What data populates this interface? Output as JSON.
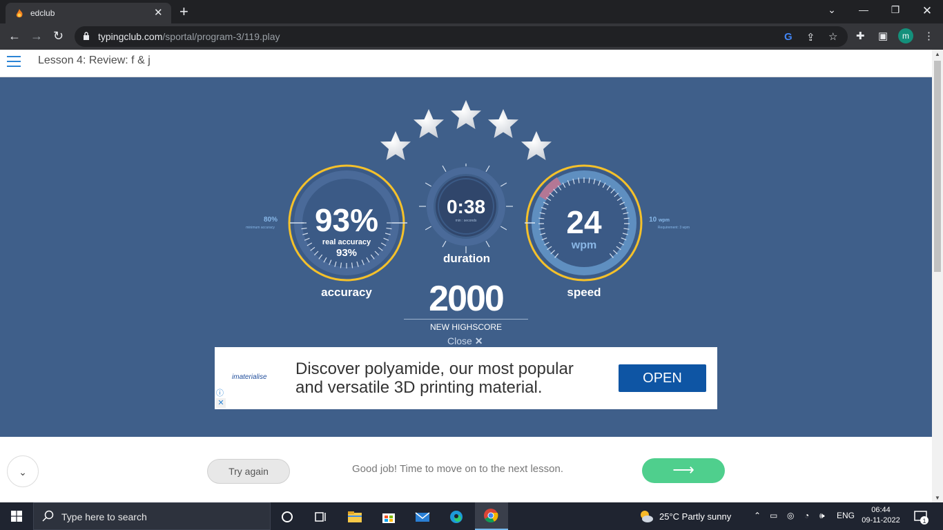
{
  "browser": {
    "tab_title": "edclub",
    "url_domain": "typingclub.com",
    "url_path": "/sportal/program-3/119.play",
    "profile_initial": "m"
  },
  "lesson": {
    "title": "Lesson 4: Review: f & j"
  },
  "results": {
    "stars": 5,
    "accuracy": {
      "value": "93%",
      "real_label": "real accuracy",
      "real_value": "93%",
      "min_value": "80%",
      "min_label": "minimum accuracy",
      "title": "accuracy",
      "fraction": 0.93
    },
    "duration": {
      "value": "0:38",
      "unit_label": "min : seconds",
      "title": "duration"
    },
    "speed": {
      "value": "24",
      "unit": "wpm",
      "req_value": "10",
      "req_unit": "wpm",
      "req_label": "Requirement: 3 wpm",
      "title": "speed"
    },
    "highscore": {
      "value": "2000",
      "label": "NEW HIGHSCORE"
    },
    "close_label": "Close"
  },
  "ad": {
    "brand": "materialise",
    "text_line1": "Discover polyamide, our most popular",
    "text_line2": "and versatile 3D printing material.",
    "cta": "OPEN"
  },
  "footer": {
    "try_again": "Try again",
    "message": "Good job! Time to move on to the next lesson.",
    "next_arrow": "⟶"
  },
  "taskbar": {
    "search_placeholder": "Type here to search",
    "weather": "25°C  Partly sunny",
    "lang": "ENG",
    "time": "06:44",
    "date": "09-11-2022",
    "notifications": "1"
  },
  "colors": {
    "stage_bg": "#3f5f8a",
    "gauge_ring": "#f5c12a",
    "next_button": "#4fcf8d",
    "ad_button": "#0e55a4"
  }
}
